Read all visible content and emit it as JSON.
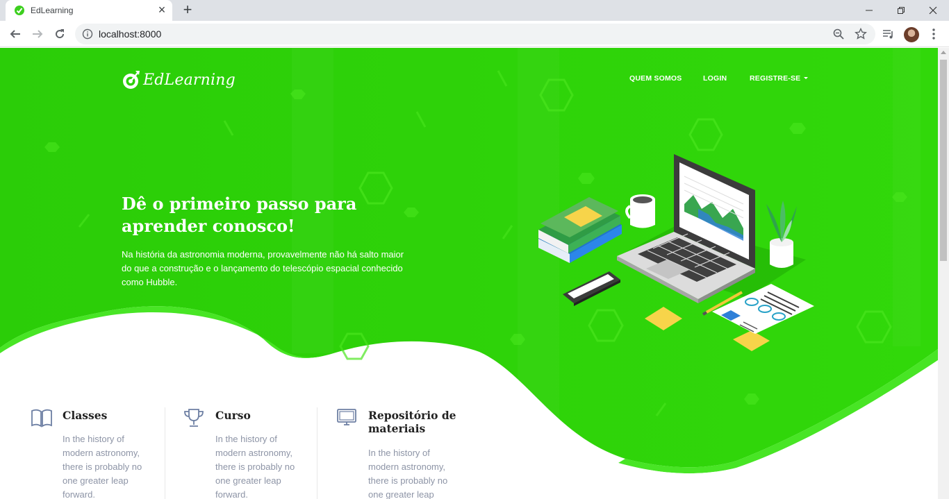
{
  "browser": {
    "tab_title": "EdLearning",
    "url": "localhost:8000"
  },
  "site": {
    "brand": "EdLearning",
    "nav": {
      "about": "QUEM SOMOS",
      "login": "LOGIN",
      "register": "REGISTRE-SE"
    },
    "hero": {
      "title": "Dê o primeiro passo para aprender conosco!",
      "text": "Na história da astronomia moderna, provavelmente não há salto maior do que a construção e o lançamento do telescópio espacial conhecido como Hubble."
    },
    "features": [
      {
        "icon": "book-icon",
        "title": "Classes",
        "text": "In the history of modern astronomy, there is probably no one greater leap forward."
      },
      {
        "icon": "trophy-icon",
        "title": "Curso",
        "text": "In the history of modern astronomy, there is probably no one greater leap forward."
      },
      {
        "icon": "monitor-icon",
        "title": "Repositório de materiais",
        "text": "In the history of modern astronomy, there is probably no one greater leap forward."
      }
    ]
  },
  "colors": {
    "hero_green": "#2fd20a",
    "hero_green_light": "#3fe019",
    "text_muted": "#8d94a6"
  }
}
